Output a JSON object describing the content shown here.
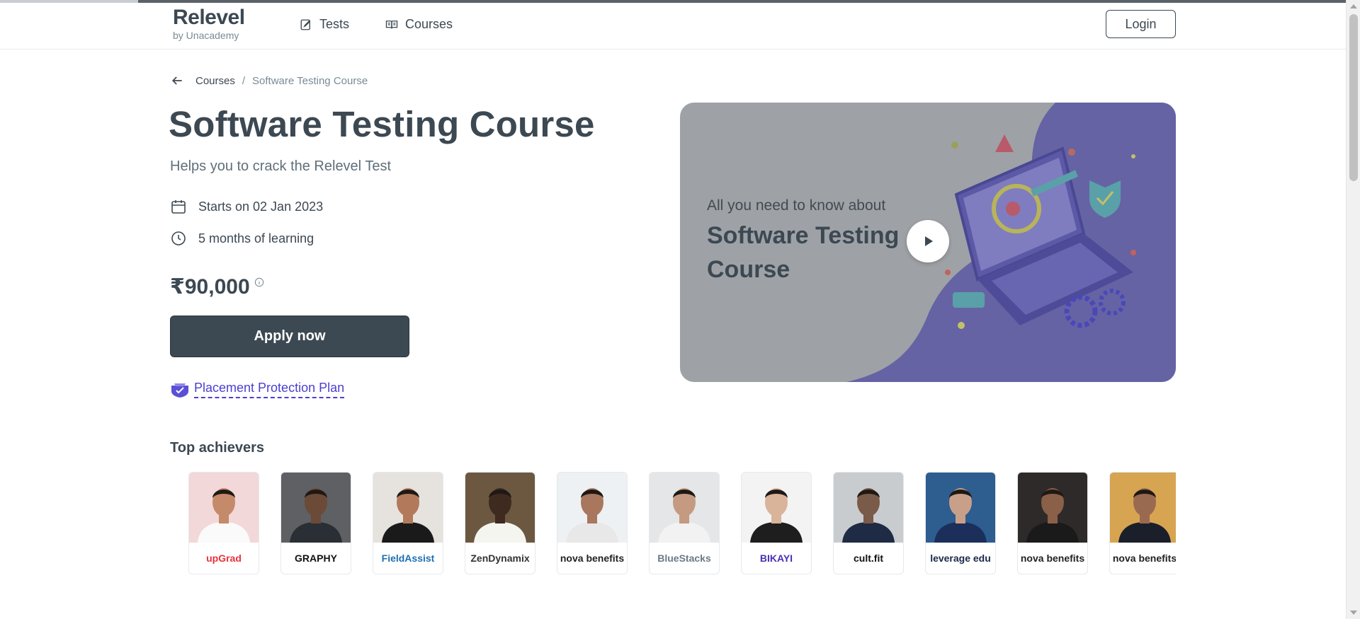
{
  "header": {
    "brand_name": "Relevel",
    "brand_by": "by Unacademy",
    "nav": [
      {
        "label": "Tests",
        "icon": "edit-icon"
      },
      {
        "label": "Courses",
        "icon": "book-icon"
      }
    ],
    "login_label": "Login"
  },
  "breadcrumb": {
    "link": "Courses",
    "separator": "/",
    "current": "Software Testing Course"
  },
  "course": {
    "title": "Software Testing Course",
    "subtitle": "Helps you to crack the Relevel Test",
    "start": "Starts on 02 Jan 2023",
    "duration": "5 months of learning",
    "price": "₹90,000",
    "apply_label": "Apply now",
    "placement_plan": "Placement Protection Plan"
  },
  "banner": {
    "eyebrow": "All you need to know about",
    "title": "Software Testing Course"
  },
  "achievers": {
    "heading": "Top achievers",
    "cards": [
      {
        "company": "upGrad",
        "color": "#e8333b"
      },
      {
        "company": "GRAPHY",
        "color": "#111111"
      },
      {
        "company": "FieldAssist",
        "color": "#1f6fb5"
      },
      {
        "company": "ZenDynamix",
        "color": "#333333"
      },
      {
        "company": "nova benefits",
        "color": "#222222"
      },
      {
        "company": "BlueStacks",
        "color": "#6a7a88"
      },
      {
        "company": "BIKAYI",
        "color": "#4b2fb8"
      },
      {
        "company": "cult.fit",
        "color": "#111111"
      },
      {
        "company": "leverage edu",
        "color": "#1b2a4a"
      },
      {
        "company": "nova benefits",
        "color": "#222222"
      },
      {
        "company": "nova benefits",
        "color": "#222222"
      }
    ]
  },
  "colors": {
    "primary": "#3c4852",
    "accent": "#4a3fd0",
    "banner_bg": "#9ea2a6",
    "banner_purple": "#6563a4"
  }
}
